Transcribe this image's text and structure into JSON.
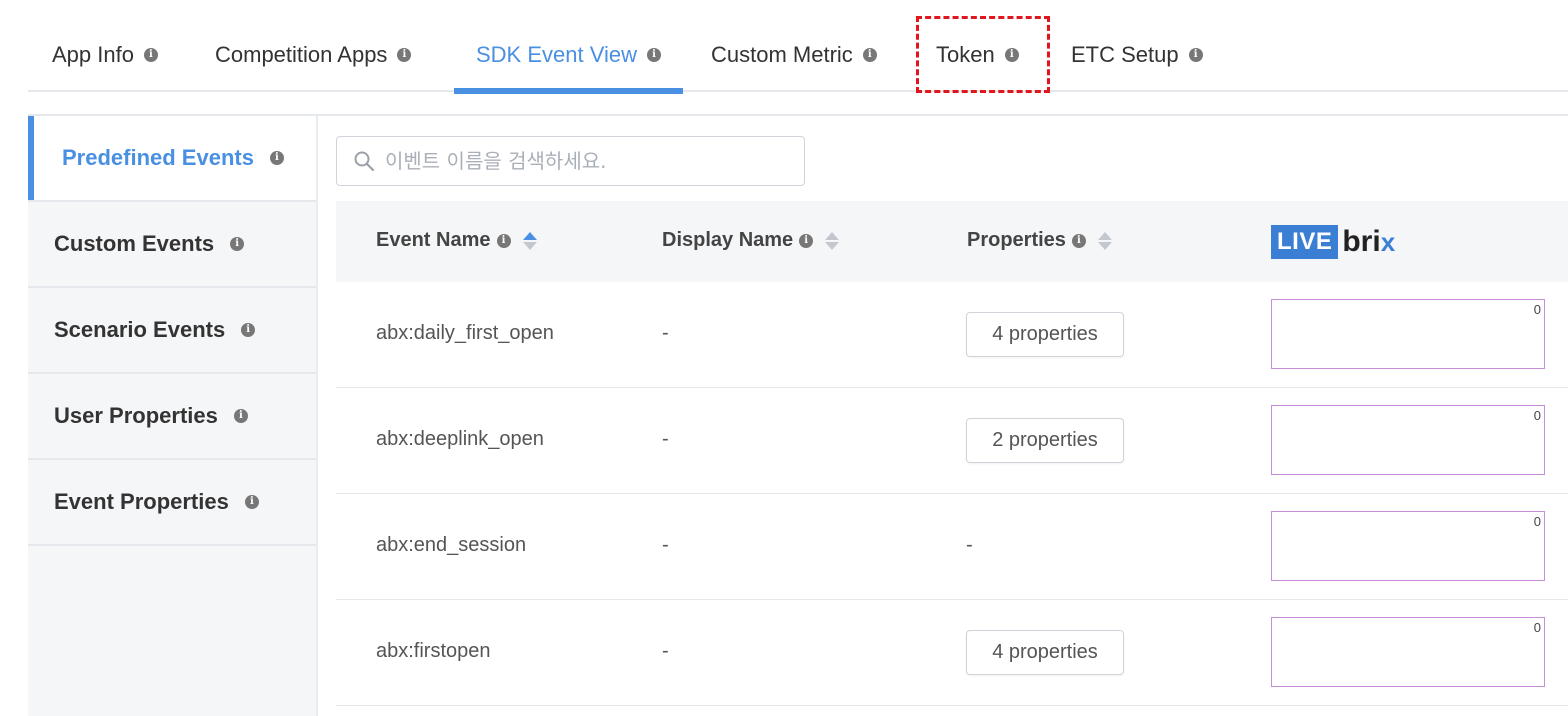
{
  "tabs": [
    {
      "label": "App Info"
    },
    {
      "label": "Competition Apps"
    },
    {
      "label": "SDK Event View"
    },
    {
      "label": "Custom Metric"
    },
    {
      "label": "Token"
    },
    {
      "label": "ETC Setup"
    }
  ],
  "active_tab": "SDK Event View",
  "highlighted_tab": "Token",
  "sidebar": {
    "items": [
      {
        "label": "Predefined Events"
      },
      {
        "label": "Custom Events"
      },
      {
        "label": "Scenario Events"
      },
      {
        "label": "User Properties"
      },
      {
        "label": "Event Properties"
      }
    ],
    "active": "Predefined Events"
  },
  "search": {
    "placeholder": "이벤트 이름을 검색하세요.",
    "value": ""
  },
  "table": {
    "columns": {
      "event_name": "Event Name",
      "display_name": "Display Name",
      "properties": "Properties"
    },
    "logo": {
      "live": "LIVE",
      "brix": "bri",
      "x": "x"
    },
    "rows": [
      {
        "event_name": "abx:daily_first_open",
        "display_name": "-",
        "properties": "4 properties",
        "live_count": "0"
      },
      {
        "event_name": "abx:deeplink_open",
        "display_name": "-",
        "properties": "2 properties",
        "live_count": "0"
      },
      {
        "event_name": "abx:end_session",
        "display_name": "-",
        "properties": "-",
        "live_count": "0"
      },
      {
        "event_name": "abx:firstopen",
        "display_name": "-",
        "properties": "4 properties",
        "live_count": "0"
      }
    ]
  },
  "colors": {
    "accent": "#4a90e2",
    "highlight": "#e0161c",
    "livebox_border": "#c98ed9"
  },
  "icons": [
    "info-icon",
    "search-icon",
    "sort-icon"
  ]
}
